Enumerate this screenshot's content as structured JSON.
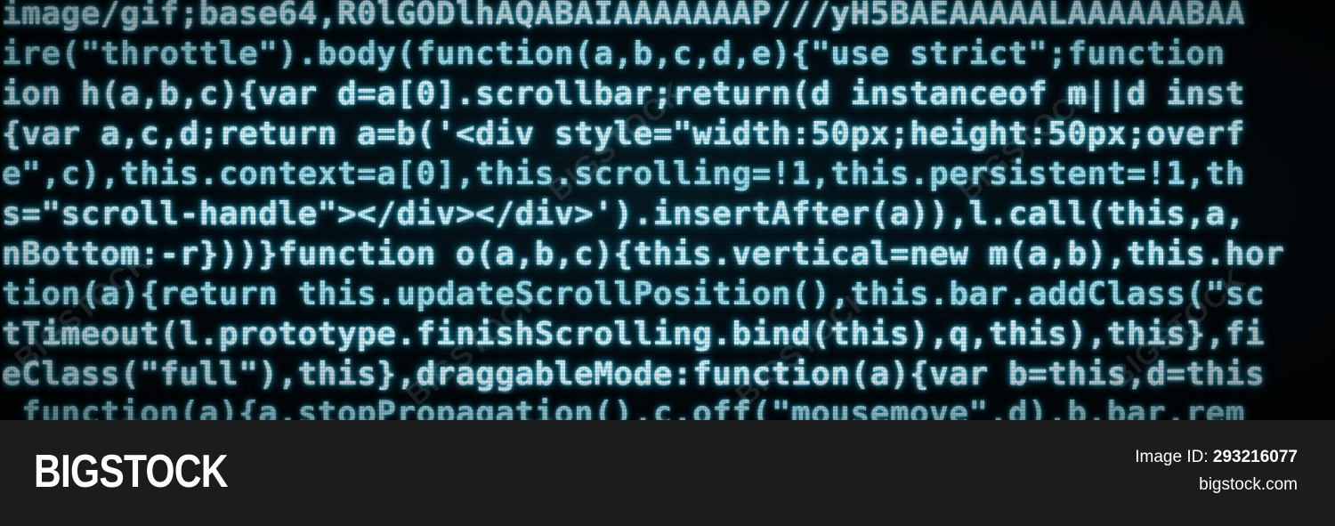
{
  "photo": {
    "code_lines": [
      "image/gif;base64,R0lGODlhAQABAIAAAAAAAP///yH5BAEAAAAALAAAAAABAA",
      "ire(\"throttle\").body(function(a,b,c,d,e){\"use strict\";function",
      "ion h(a,b,c){var d=a[0].scrollbar;return(d instanceof m||d inst",
      "{var a,c,d;return a=b('<div style=\"width:50px;height:50px;overf",
      "e\",c),this.context=a[0],this.scrolling=!1,this.persistent=!1,th",
      "s=\"scroll-handle\"></div></div>').insertAfter(a)),l.call(this,a,",
      "nBottom:-r}))}function o(a,b,c){this.vertical=new m(a,b),this.hor",
      "tion(a){return this.updateScrollPosition(),this.bar.addClass(\"sc",
      "tTimeout(l.prototype.finishScrolling.bind(this),q,this),this},fi",
      "eClass(\"full\"),this},draggableMode:function(a){var b=this,d=this",
      " function(a){a.stopPropagation(),c.off(\"mousemove\",d),b.bar.rem"
    ],
    "watermark_text": "BIGSTOCK",
    "colors": {
      "glyph": "#cfeff7",
      "glow": "#2fb8d8",
      "background": "#02080c"
    }
  },
  "footer": {
    "brand": "BIGSTOCK",
    "image_id_label": "Image ID:",
    "image_id_value": "293216077",
    "site_url": "bigstock.com",
    "colors": {
      "background": "#1c1c1c",
      "text": "#ffffff"
    }
  }
}
